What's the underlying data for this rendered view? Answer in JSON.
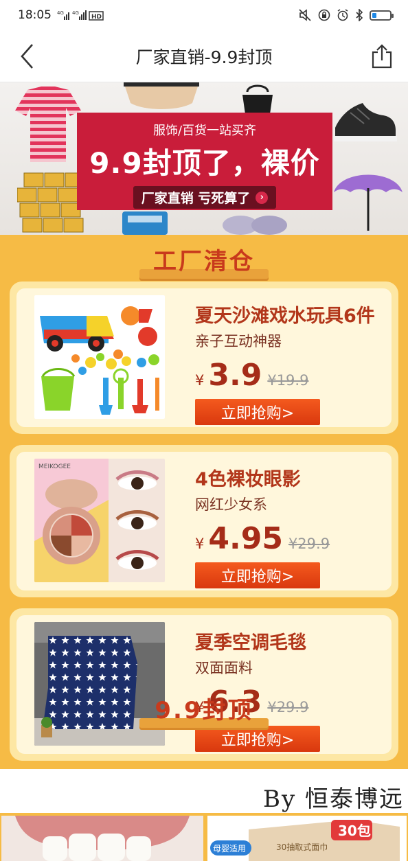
{
  "status": {
    "time": "18:05",
    "network": "4G 4G HD",
    "icons": [
      "mute-icon",
      "lock-rotation-icon",
      "alarm-icon",
      "bluetooth-icon",
      "battery-icon"
    ]
  },
  "nav": {
    "title": "厂家直销-9.9封顶",
    "back_icon": "chevron-left-icon",
    "share_icon": "share-icon"
  },
  "hero": {
    "subtitle": "服饰/百货一站买齐",
    "headline": "9.9封顶了，裸价",
    "tag": "厂家直销 亏死算了",
    "tag_arrow": "›"
  },
  "section1": {
    "title": "工厂清仓"
  },
  "products": [
    {
      "title": "夏天沙滩戏水玩具6件",
      "desc": "亲子互动神器",
      "yen": "¥",
      "price": "3.9",
      "old_price": "¥19.9",
      "button": "立即抢购>",
      "image": "beach-toys"
    },
    {
      "title": "4色裸妆眼影",
      "desc": "网红少女系",
      "yen": "¥",
      "price": "4.95",
      "old_price": "¥29.9",
      "button": "立即抢购>",
      "image": "eyeshadow",
      "brand": "MEIKOGEE"
    },
    {
      "title": "夏季空调毛毯",
      "desc": "双面面料",
      "yen": "¥",
      "price": "6.3",
      "old_price": "¥29.9",
      "button": "立即抢购>",
      "image": "star-blanket"
    }
  ],
  "section2": {
    "title": "9.9封顶"
  },
  "watermark": "By 恒泰博远",
  "bottom_items": [
    {
      "image": "teeth"
    },
    {
      "badge": "30包",
      "label": "母婴适用",
      "box_text": "30抽取式面巾"
    }
  ],
  "colors": {
    "accent": "#c91d3a",
    "gold": "#f6bb45",
    "price": "#a52c18",
    "button": "#e9471a"
  }
}
